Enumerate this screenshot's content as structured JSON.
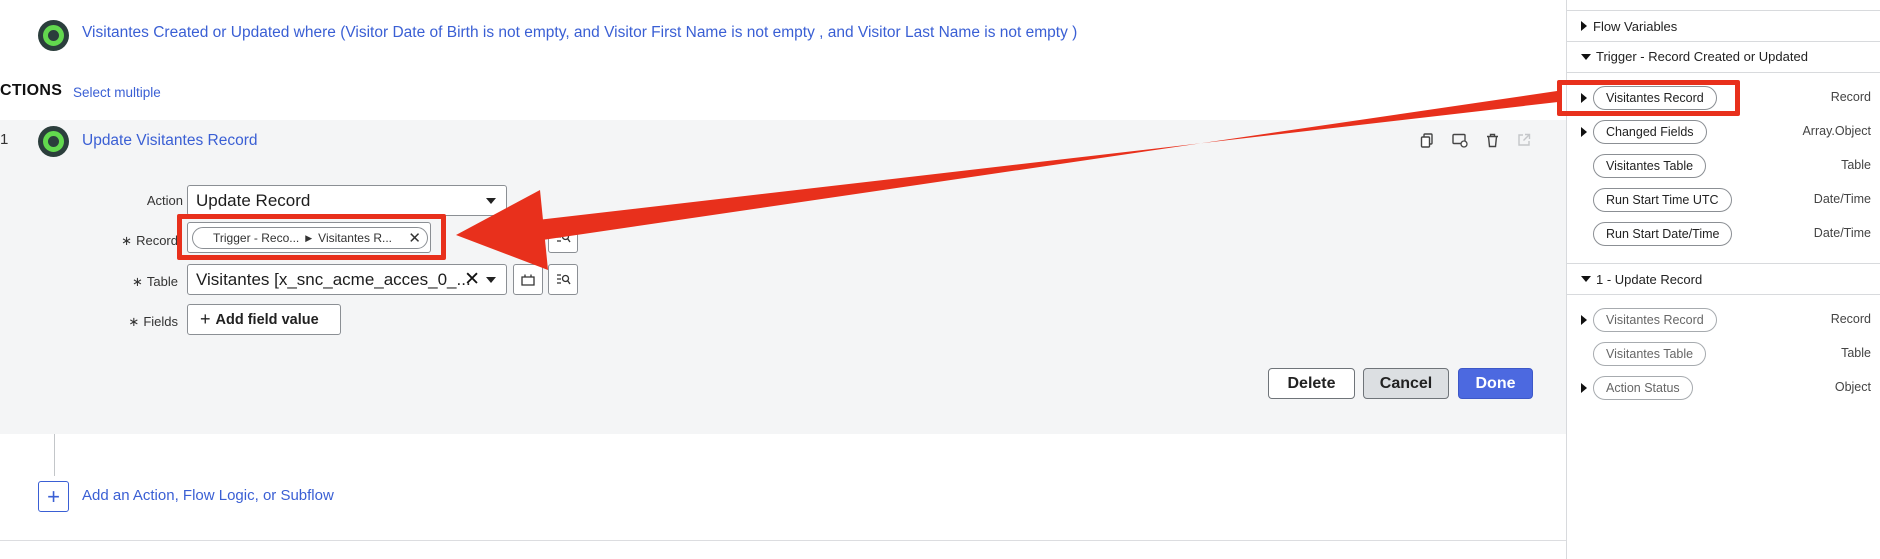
{
  "trigger": {
    "text": "Visitantes Created or Updated where (Visitor Date of Birth is not empty, and Visitor First Name is not empty , and Visitor Last Name is not empty )"
  },
  "actions_header": {
    "title": "CTIONS",
    "select_multiple": "Select multiple"
  },
  "step": {
    "number": "1",
    "title": "Update Visitantes Record"
  },
  "form": {
    "action_label": "Action",
    "action_value": "Update Record",
    "record_label": "Record",
    "record_pill_part1": "Trigger - Reco...",
    "record_pill_part2": "Visitantes R...",
    "table_label": "Table",
    "table_value": "Visitantes [x_snc_acme_acces_0_...",
    "fields_label": "Fields",
    "add_field_label": "Add field value",
    "required_mark": "∗"
  },
  "buttons": {
    "delete": "Delete",
    "cancel": "Cancel",
    "done": "Done"
  },
  "add_action": {
    "label": "Add an Action, Flow Logic, or Subflow"
  },
  "right_panel": {
    "flow_variables": "Flow Variables",
    "trigger_section": "Trigger - Record Created or Updated",
    "trigger_items": [
      {
        "label": "Visitantes Record",
        "type": "Record"
      },
      {
        "label": "Changed Fields",
        "type": "Array.Object"
      },
      {
        "label": "Visitantes Table",
        "type": "Table"
      },
      {
        "label": "Run Start Time UTC",
        "type": "Date/Time"
      },
      {
        "label": "Run Start Date/Time",
        "type": "Date/Time"
      }
    ],
    "update_section": "1 - Update Record",
    "update_items": [
      {
        "label": "Visitantes Record",
        "type": "Record"
      },
      {
        "label": "Visitantes Table",
        "type": "Table"
      },
      {
        "label": "Action Status",
        "type": "Object"
      }
    ]
  },
  "colors": {
    "link_blue": "#3a5fd4",
    "accent_green": "#62d84e",
    "highlight_red": "#e8301c",
    "done_blue": "#4c69e0"
  }
}
